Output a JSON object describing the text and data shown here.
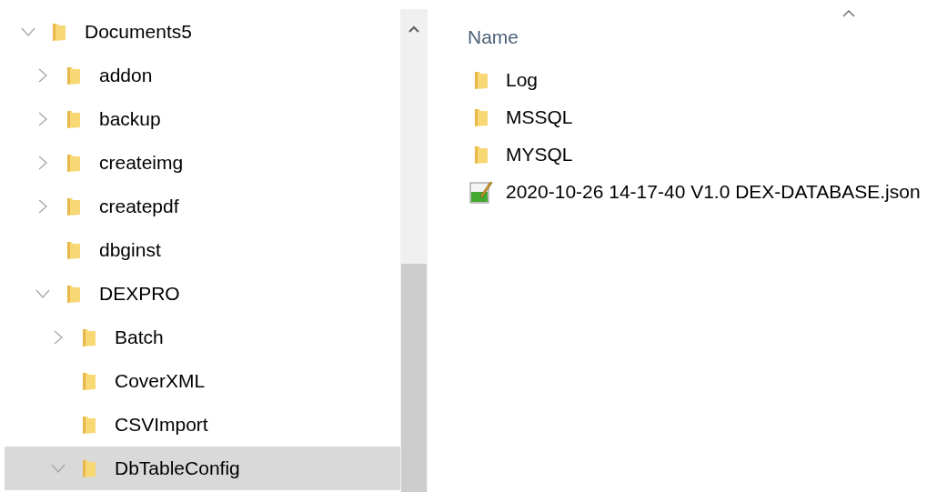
{
  "tree": [
    {
      "label": "Documents5",
      "kind": "branch",
      "expanded": true,
      "selected": false,
      "children": [
        {
          "label": "addon",
          "kind": "branch",
          "expanded": false,
          "selected": false
        },
        {
          "label": "backup",
          "kind": "branch",
          "expanded": false,
          "selected": false
        },
        {
          "label": "createimg",
          "kind": "branch",
          "expanded": false,
          "selected": false
        },
        {
          "label": "createpdf",
          "kind": "branch",
          "expanded": false,
          "selected": false
        },
        {
          "label": "dbginst",
          "kind": "leaf",
          "selected": false
        },
        {
          "label": "DEXPRO",
          "kind": "branch",
          "expanded": true,
          "selected": false,
          "children": [
            {
              "label": "Batch",
              "kind": "branch",
              "expanded": false,
              "selected": false
            },
            {
              "label": "CoverXML",
              "kind": "leaf",
              "selected": false
            },
            {
              "label": "CSVImport",
              "kind": "leaf",
              "selected": false
            },
            {
              "label": "DbTableConfig",
              "kind": "branch",
              "expanded": true,
              "selected": true
            }
          ]
        }
      ]
    }
  ],
  "list": {
    "column": "Name",
    "sorted_ascending": true,
    "items": [
      {
        "name": "Log",
        "kind": "folder"
      },
      {
        "name": "MSSQL",
        "kind": "folder"
      },
      {
        "name": "MYSQL",
        "kind": "folder"
      },
      {
        "name": "2020-10-26 14-17-40 V1.0 DEX-DATABASE.json",
        "kind": "json"
      }
    ]
  }
}
